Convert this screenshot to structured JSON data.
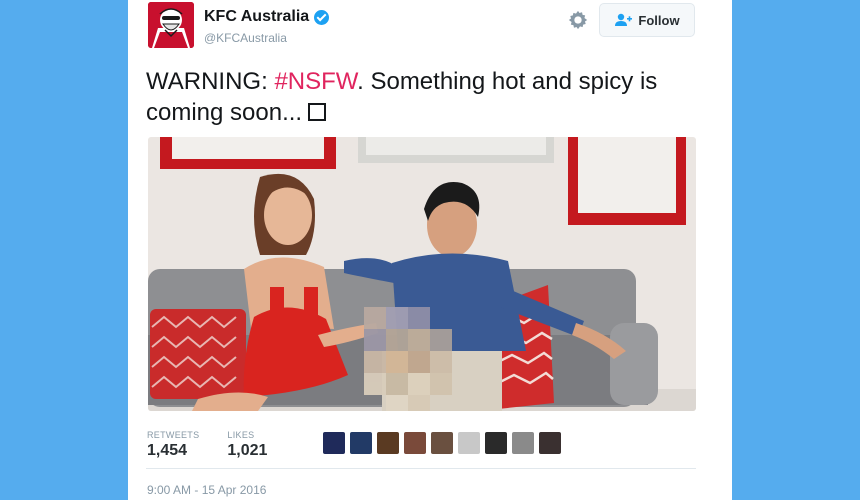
{
  "tweet": {
    "author": {
      "display_name": "KFC Australia",
      "handle": "@KFCAustralia",
      "verified": true,
      "avatar_icon": "kfc-colonel-logo"
    },
    "header": {
      "settings_icon": "gear-icon",
      "follow_label": "Follow"
    },
    "text": {
      "prefix": "WARNING: ",
      "hashtag": "#NSFW",
      "suffix": ". Something hot and spicy is coming soon..."
    },
    "stats": {
      "retweets_label": "RETWEETS",
      "retweets_value": "1,454",
      "likes_label": "LIKES",
      "likes_value": "1,021"
    },
    "likers_count_shown": 9,
    "timestamp": "9:00 AM - 15 Apr 2016"
  },
  "colors": {
    "page_background": "#55acee",
    "card_background": "#ffffff",
    "hashtag": "#e0245e",
    "verified_badge": "#1da1f2",
    "kfc_red": "#c8102e",
    "muted_text": "#8899a6"
  }
}
